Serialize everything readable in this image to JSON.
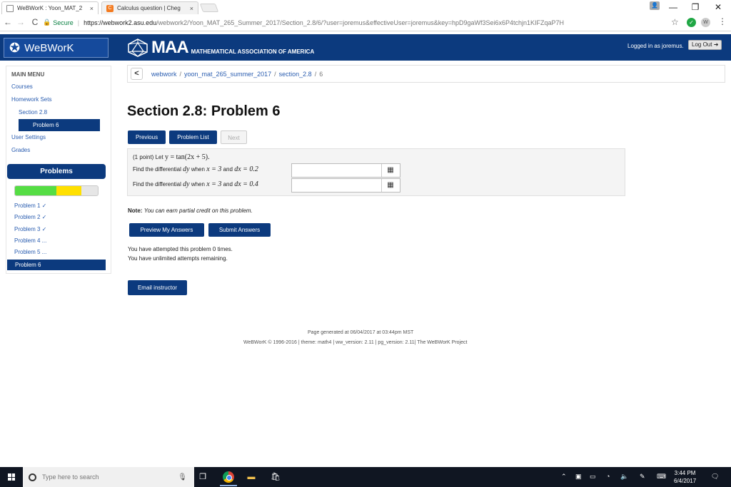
{
  "browser": {
    "tabs": [
      {
        "title": "WeBWorK : Yoon_MAT_2",
        "close": "×"
      },
      {
        "title": "Calculus question | Cheg",
        "close": "×"
      }
    ],
    "chegg_letter": "C",
    "window_controls": {
      "minimize": "—",
      "maximize": "❐",
      "close": "✕"
    },
    "back": "←",
    "forward": "→",
    "reload": "C",
    "secure_label": "Secure",
    "url_host": "https://webwork2.asu.edu",
    "url_path": "/webwork2/Yoon_MAT_265_Summer_2017/Section_2.8/6/?user=joremus&effectiveUser=joremus&key=hpD9gaWf3Sei6x6P4tchjn1KIFZqaP7H",
    "star": "☆",
    "ext1": "✓",
    "ext2": "W",
    "menu": "⋮"
  },
  "header": {
    "logo_text": "WeBWorK",
    "maa_big": "MAA",
    "maa_small": "MATHEMATICAL ASSOCIATION OF AMERICA",
    "logged_in": "Logged in as joremus.",
    "logout_label": "Log Out ➜"
  },
  "sidebar": {
    "title": "MAIN MENU",
    "links": {
      "courses": "Courses",
      "homework_sets": "Homework Sets",
      "section": "Section 2.8",
      "problem_active": "Problem 6",
      "user_settings": "User Settings",
      "grades": "Grades"
    },
    "problems_header": "Problems",
    "progress": {
      "correct": 0.5,
      "partial": 0.3,
      "colors": {
        "correct": "#55dd44",
        "partial": "#ffe000"
      }
    },
    "problems": [
      "Problem 1 ✓",
      "Problem 2 ✓",
      "Problem 3 ✓",
      "Problem 4 ...",
      "Problem 5 ...",
      "Problem 6"
    ]
  },
  "breadcrumb": {
    "back": "<",
    "items": [
      "webwork",
      "yoon_mat_265_summer_2017",
      "section_2.8",
      "6"
    ],
    "separator": "/"
  },
  "main": {
    "title": "Section 2.8: Problem 6",
    "buttons": {
      "previous": "Previous",
      "problem_list": "Problem List",
      "next": "Next"
    },
    "problem": {
      "intro": "(1 point) Let",
      "function": "y = tan(2x + 5).",
      "q1_prefix": "Find the differential",
      "q1_dy": "dy",
      "q1_when": "when",
      "q1_cond": "x = 3",
      "q1_and": "and",
      "q1_dx": "dx = 0.2",
      "q2_prefix": "Find the differential",
      "q2_dy": "dy",
      "q2_when": "when",
      "q2_cond": "x = 3",
      "q2_and": "and",
      "q2_dx": "dx = 0.4",
      "answer1": "",
      "answer2": "",
      "mathquill_icon": "▦"
    },
    "note_label": "Note:",
    "note_text": "You can earn partial credit on this problem.",
    "preview_button": "Preview My Answers",
    "submit_button": "Submit Answers",
    "attempts_line1": "You have attempted this problem 0 times.",
    "attempts_line2": "You have unlimited attempts remaining.",
    "email_button": "Email instructor"
  },
  "footer": {
    "generated": "Page generated at 06/04/2017 at 03:44pm MST",
    "credits": "WeBWorK © 1996-2016 | theme: math4 | ww_version: 2.11 | pg_version: 2.11| The WeBWorK Project"
  },
  "taskbar": {
    "search_placeholder": "Type here to search",
    "time": "3:44 PM",
    "date": "6/4/2017"
  }
}
